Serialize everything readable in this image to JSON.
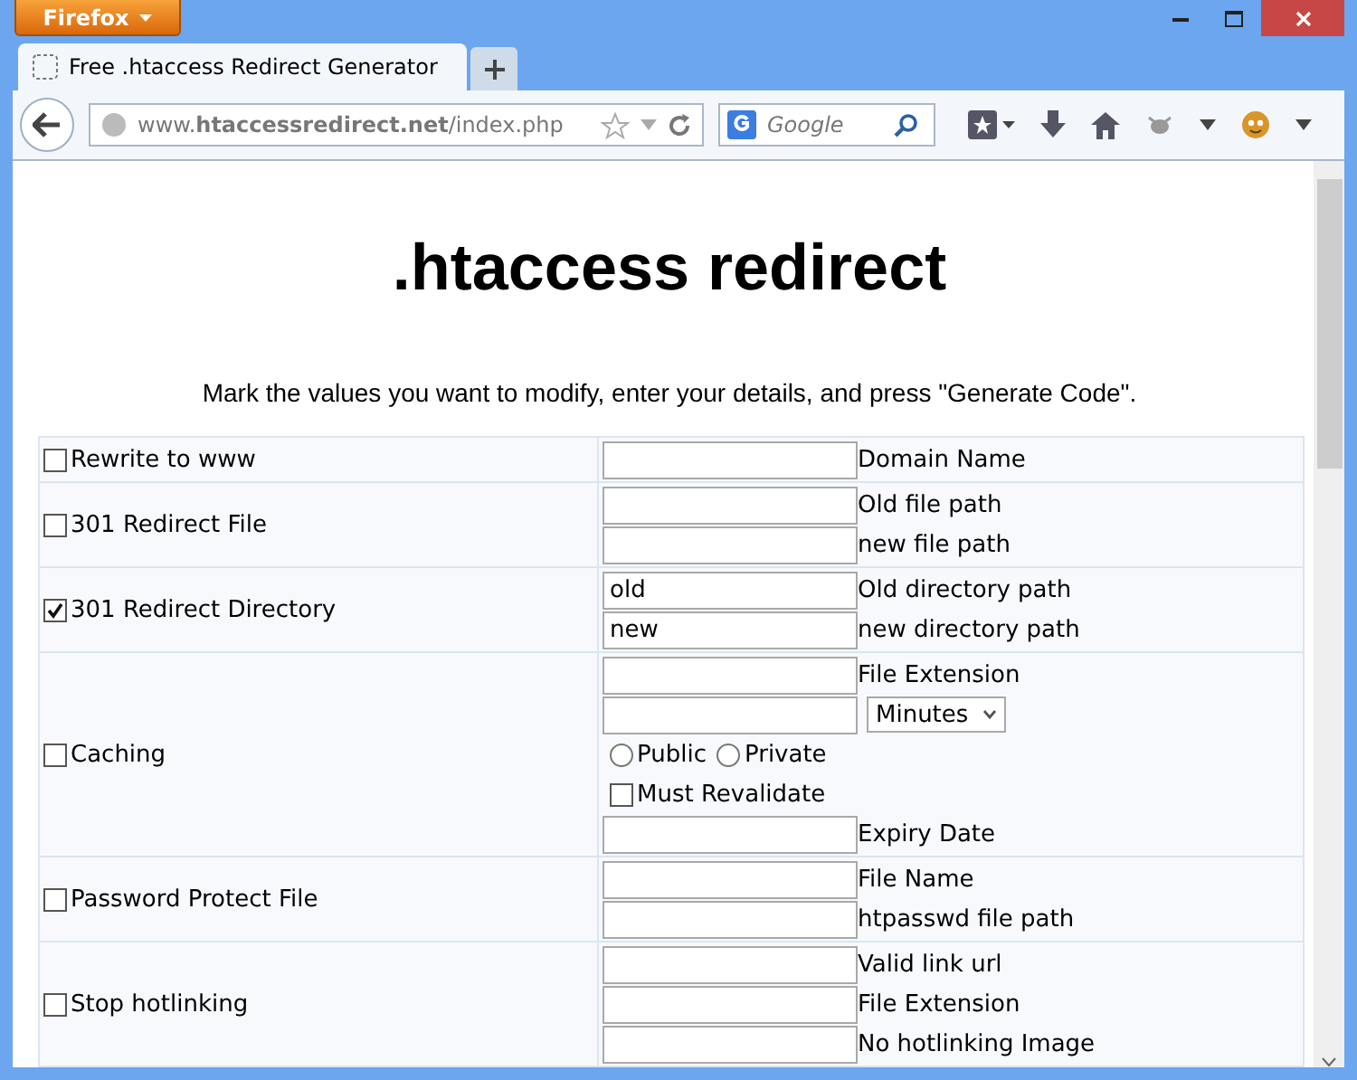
{
  "browser": {
    "menu_button": "Firefox",
    "tabs": [
      {
        "title": "Free .htaccess Redirect Generator",
        "selected": true
      }
    ],
    "url": "www.**htaccessredirect.net**/index.php",
    "search": {
      "placeholder": "Google"
    }
  },
  "page": {
    "title": ".htaccess redirect",
    "intro": "Mark the values you want to modify, enter your details, and press \"Generate Code\".",
    "options": [
      {
        "label": "Rewrite to www",
        "checked": false,
        "items": [
          {
            "kind": "field",
            "value": "",
            "label": "Domain Name"
          }
        ]
      },
      {
        "label": "301 Redirect File",
        "checked": false,
        "items": [
          {
            "kind": "field",
            "value": "",
            "label": "Old file path"
          },
          {
            "kind": "field",
            "value": "",
            "label": "new file path"
          }
        ]
      },
      {
        "label": "301 Redirect Directory",
        "checked": true,
        "items": [
          {
            "kind": "field",
            "value": "old",
            "label": "Old directory path"
          },
          {
            "kind": "field",
            "value": "new",
            "label": "new directory path"
          }
        ]
      },
      {
        "label": "Caching",
        "checked": false,
        "items": [
          {
            "kind": "field",
            "value": "",
            "label": "File Extension"
          },
          {
            "kind": "select",
            "value": "",
            "option": "Minutes"
          },
          {
            "kind": "radios",
            "options": [
              {
                "label": "Public",
                "selected": false
              },
              {
                "label": "Private",
                "selected": false
              }
            ]
          },
          {
            "kind": "checkbox",
            "label": "Must Revalidate",
            "checked": false
          },
          {
            "kind": "field",
            "value": "",
            "label": "Expiry Date"
          }
        ]
      },
      {
        "label": "Password Protect File",
        "checked": false,
        "items": [
          {
            "kind": "field",
            "value": "",
            "label": "File Name"
          },
          {
            "kind": "field",
            "value": "",
            "label": "htpasswd file path"
          }
        ]
      },
      {
        "label": "Stop hotlinking",
        "checked": false,
        "items": [
          {
            "kind": "field",
            "value": "",
            "label": "Valid link url"
          },
          {
            "kind": "field",
            "value": "",
            "label": "File Extension"
          },
          {
            "kind": "field",
            "value": "",
            "label": "No hotlinking Image"
          }
        ]
      }
    ]
  }
}
